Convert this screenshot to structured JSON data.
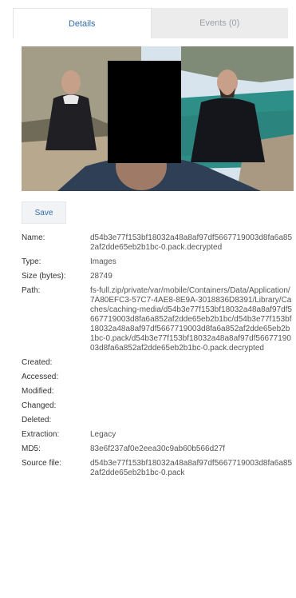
{
  "tabs": [
    {
      "label": "Details"
    },
    {
      "label": "Events (0)"
    }
  ],
  "toolbar": {
    "save_label": "Save"
  },
  "properties": [
    {
      "key": "Name:",
      "value": "d54b3e77f153bf18032a48a8af97df5667719003d8fa6a852af2dde65eb2b1bc-0.pack.decrypted"
    },
    {
      "key": "Type:",
      "value": "Images"
    },
    {
      "key": "Size (bytes):",
      "value": "28749"
    },
    {
      "key": "Path:",
      "value": "fs-full.zip/private/var/mobile/Containers/Data/Application/7A80EFC3-57C7-4AE8-8E9A-3018836D8391/Library/Caches/caching-media/d54b3e77f153bf18032a48a8af97df5667719003d8fa6a852af2dde65eb2b1bc/d54b3e77f153bf18032a48a8af97df5667719003d8fa6a852af2dde65eb2b1bc-0.pack/d54b3e77f153bf18032a48a8af97df5667719003d8fa6a852af2dde65eb2b1bc-0.pack.decrypted"
    },
    {
      "key": "Created:",
      "value": ""
    },
    {
      "key": "Accessed:",
      "value": ""
    },
    {
      "key": "Modified:",
      "value": ""
    },
    {
      "key": "Changed:",
      "value": ""
    },
    {
      "key": "Deleted:",
      "value": ""
    },
    {
      "key": "Extraction:",
      "value": "Legacy"
    },
    {
      "key": "MD5:",
      "value": "83e6f237af0e2eea30c9ab60b566d27f"
    },
    {
      "key": "Source file:",
      "value": "d54b3e77f153bf18032a48a8af97df5667719003d8fa6a852af2dde65eb2b1bc-0.pack"
    }
  ]
}
